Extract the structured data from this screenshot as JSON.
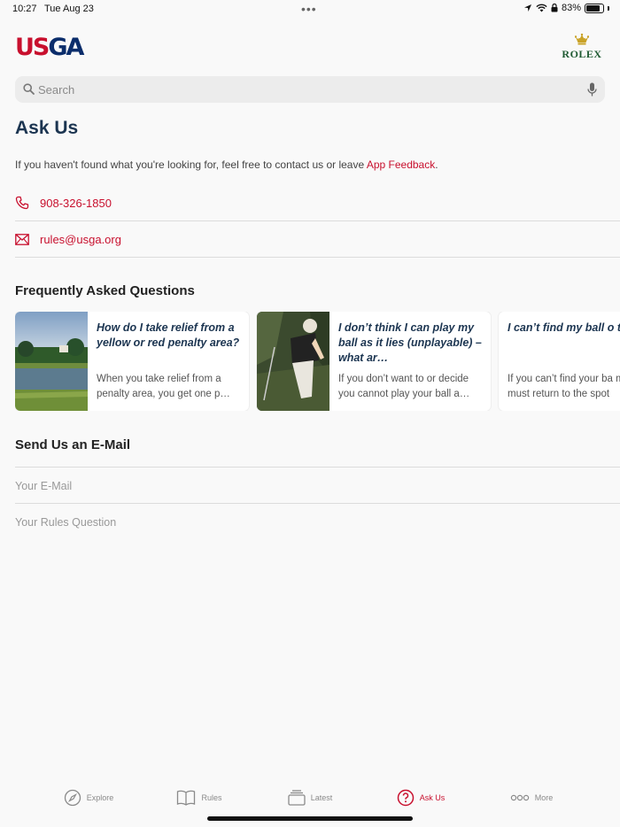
{
  "status": {
    "time": "10:27",
    "date": "Tue Aug 23",
    "dots": "•••",
    "battery": "83%",
    "battery_level": 0.83
  },
  "header": {
    "logo_us": "US",
    "logo_ga": "GA",
    "sponsor": "ROLEX"
  },
  "search": {
    "placeholder": "Search"
  },
  "ask_us": {
    "title": "Ask Us",
    "intro": "If you haven't found what you're looking for, feel free to contact us or leave ",
    "feedback_link": "App Feedback",
    "intro_end": ".",
    "phone": "908-326-1850",
    "email": "rules@usga.org"
  },
  "faq": {
    "title": "Frequently Asked Questions",
    "cards": [
      {
        "question": "How do I take relief from a yellow or red penalty area?",
        "answer": "When you take relief from a penalty area, you get one p…"
      },
      {
        "question": "I don’t think I can play my ball as it lies (unplayable) – what ar…",
        "answer": "If you don’t want to or decide you cannot play your ball a…"
      },
      {
        "question": "I can’t find my ball o three minutes – wha",
        "answer": "If you can’t find your ba minutes, it is lost. Beca must return to the spot"
      }
    ]
  },
  "email_form": {
    "title": "Send Us an E-Mail",
    "email_placeholder": "Your E-Mail",
    "question_placeholder": "Your Rules Question"
  },
  "tabs": [
    {
      "label": "Explore",
      "icon": "compass-icon",
      "active": false
    },
    {
      "label": "Rules",
      "icon": "book-icon",
      "active": false
    },
    {
      "label": "Latest",
      "icon": "stack-icon",
      "active": false
    },
    {
      "label": "Ask Us",
      "icon": "question-icon",
      "active": true
    },
    {
      "label": "More",
      "icon": "ellipsis-icon",
      "active": false
    }
  ],
  "colors": {
    "accent": "#c8102e",
    "navy": "#1c3551",
    "rolex_green": "#1e5a32"
  }
}
